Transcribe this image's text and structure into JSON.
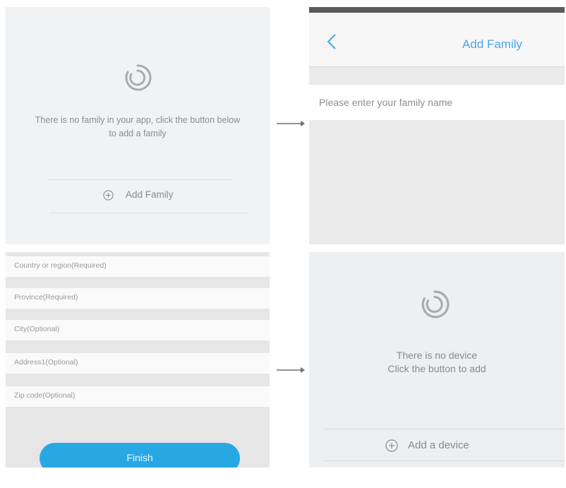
{
  "screens": {
    "no_family": {
      "message_line1": "There is no family in your app, click the button below",
      "message_line2": "to add a family",
      "add_family_label": "Add Family"
    },
    "add_family": {
      "title": "Add Family",
      "name_placeholder": "Please enter your family name"
    },
    "address_form": {
      "fields": [
        {
          "placeholder": "Country or region(Required)"
        },
        {
          "placeholder": "Province(Required)"
        },
        {
          "placeholder": "City(Optional)"
        },
        {
          "placeholder": "Address1(Optional)"
        },
        {
          "placeholder": "Zip code(Optional)"
        }
      ],
      "finish_label": "Finish"
    },
    "no_device": {
      "message_line1": "There is no device",
      "message_line2": "Click the button to add",
      "add_device_label": "Add a device"
    }
  },
  "icons": {
    "logo": "swirl-logo-icon",
    "plus": "plus-circle-icon",
    "back": "chevron-left-icon",
    "arrow": "arrow-right-icon"
  },
  "colors": {
    "accent": "#4aa6e6",
    "finish_button": "#28a8e3"
  }
}
